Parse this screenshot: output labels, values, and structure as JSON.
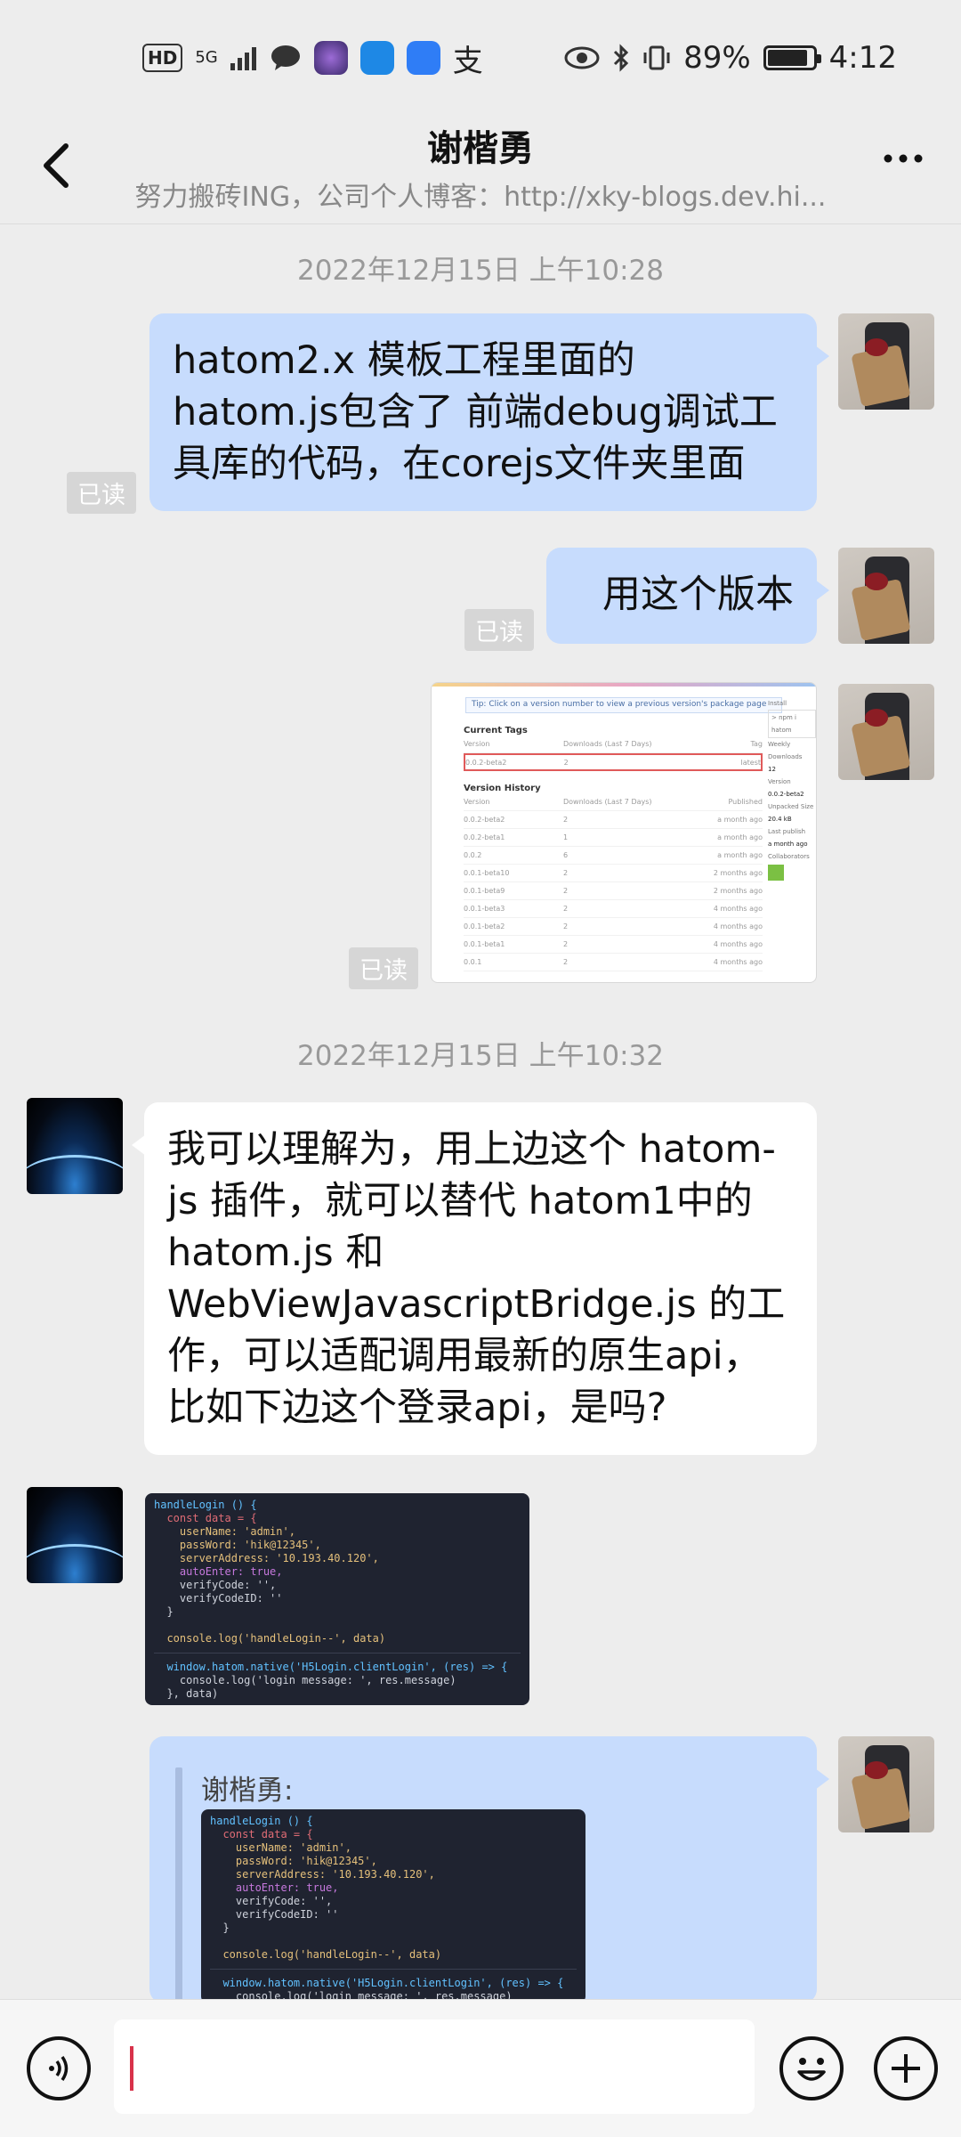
{
  "status_bar": {
    "hd": "HD",
    "signal": "5G",
    "battery_pct": "89%",
    "battery_level": 0.89,
    "time": "4:12"
  },
  "header": {
    "title": "谢楷勇",
    "subtitle": "努力搬砖ING，公司个人博客：http://xky-blogs.dev.hi...",
    "back_icon": "chevron-left-icon",
    "more_icon": "more-dots-icon"
  },
  "messages": {
    "time1": "2022年12月15日 上午10:28",
    "msg1": "hatom2.x 模板工程里面的hatom.js包含了 前端debug调试工具库的代码，在corejs文件夹里面",
    "msg2": "用这个版本",
    "read_label": "已读",
    "time2": "2022年12月15日 上午10:32",
    "msg4": "我可以理解为，用上边这个 hatom-js 插件，就可以替代 hatom1中的  hatom.js 和 WebViewJavascriptBridge.js 的工作，可以适配调用最新的原生api，比如下边这个登录api，是吗?",
    "quote_sender": "谢楷勇:"
  },
  "npm_screenshot": {
    "tip": "Tip: Click on a version number to view a previous version's package page",
    "current_tags": "Current Tags",
    "version_history": "Version History",
    "headers": [
      "Version",
      "Downloads (Last 7 Days)",
      "Tag"
    ],
    "history_headers": [
      "Version",
      "Downloads (Last 7 Days)",
      "Published"
    ],
    "current_row": [
      "0.0.2-beta2",
      "2",
      "latest"
    ],
    "history_rows": [
      [
        "0.0.2-beta2",
        "2",
        "a month ago"
      ],
      [
        "0.0.2-beta1",
        "1",
        "a month ago"
      ],
      [
        "0.0.2",
        "6",
        "a month ago"
      ],
      [
        "0.0.1-beta10",
        "2",
        "2 months ago"
      ],
      [
        "0.0.1-beta9",
        "2",
        "2 months ago"
      ],
      [
        "0.0.1-beta3",
        "2",
        "4 months ago"
      ],
      [
        "0.0.1-beta2",
        "2",
        "4 months ago"
      ],
      [
        "0.0.1-beta1",
        "2",
        "4 months ago"
      ],
      [
        "0.0.1",
        "2",
        "4 months ago"
      ]
    ],
    "side": [
      "Install",
      "> npm i hatom",
      "Weekly Downloads",
      "12",
      "Version",
      "0.0.2-beta2",
      "Unpacked Size",
      "20.4 kB",
      "Last publish",
      "a month ago",
      "Collaborators"
    ]
  },
  "code": {
    "l1": "handleLogin () {",
    "l2": "  const data = {",
    "l3": "    userName: 'admin',",
    "l4": "    passWord: 'hik@12345',",
    "l5": "    serverAddress: '10.193.40.120',",
    "l6": "    autoEnter: true,",
    "l7": "    verifyCode: '',",
    "l8": "    verifyCodeID: ''",
    "l9": "  }",
    "l10": "  console.log('handleLogin--', data)",
    "l11": "  window.hatom.native('H5Login.clientLogin', (res) => {",
    "l12": "    console.log('login message: ', res.message)",
    "l13": "  }, data)"
  },
  "input_bar": {
    "voice_icon": "voice-icon",
    "emoji_icon": "emoji-icon",
    "plus_icon": "plus-icon"
  }
}
